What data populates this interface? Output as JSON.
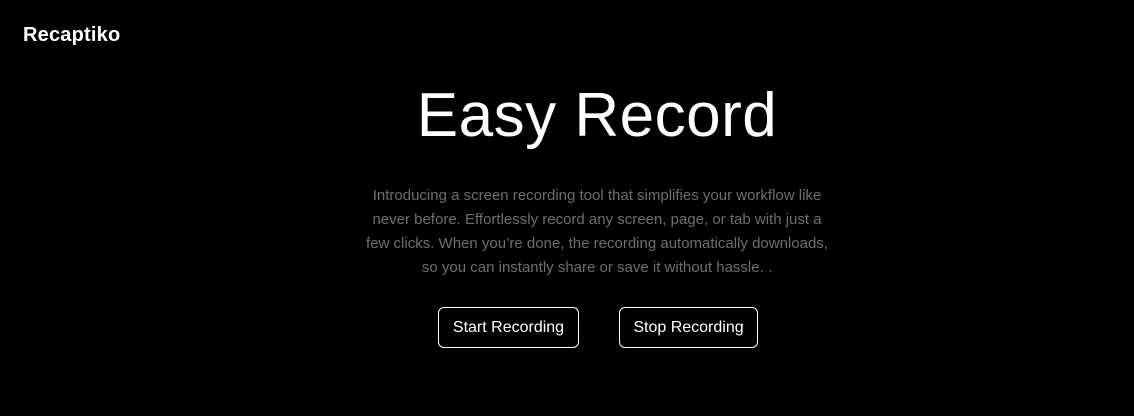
{
  "header": {
    "logo": "Recaptiko"
  },
  "hero": {
    "title": "Easy Record",
    "description_lines": [
      "Introducing a screen recording tool that simplifies your workflow like",
      "never before. Effortlessly record any screen, page, or tab with just a",
      "few clicks. When you’re done, the recording automatically downloads,",
      "so you can instantly share or save it without hassle. ."
    ],
    "start_label": "Start Recording",
    "stop_label": "Stop Recording"
  }
}
